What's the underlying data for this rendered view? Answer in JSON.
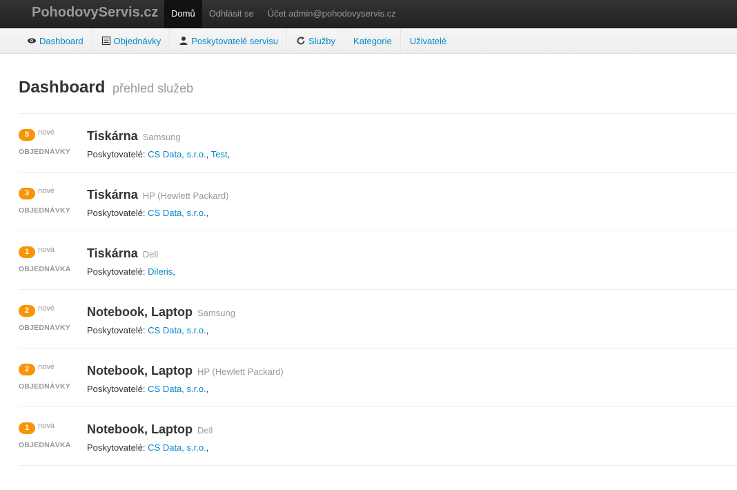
{
  "navbar": {
    "brand": "PohodovyServis.cz",
    "links": [
      {
        "label": "Domů",
        "active": true
      },
      {
        "label": "Odhlásit se",
        "active": false
      },
      {
        "label": "Účet admin@pohodovyservis.cz",
        "active": false
      }
    ]
  },
  "subnav": {
    "items": [
      {
        "label": "Dashboard",
        "icon": "eye-icon"
      },
      {
        "label": "Objednávky",
        "icon": "list-icon"
      },
      {
        "label": "Poskytovatelé servisu",
        "icon": "user-icon"
      },
      {
        "label": "Služby",
        "icon": "refresh-icon"
      },
      {
        "label": "Kategorie",
        "icon": ""
      },
      {
        "label": "Uživatelé",
        "icon": ""
      }
    ]
  },
  "page": {
    "title": "Dashboard",
    "subtitle": "přehled služeb"
  },
  "providers_label": "Poskytovatelé:",
  "services": [
    {
      "count": "5",
      "new_label": "nové",
      "order_label": "OBJEDNÁVKY",
      "category": "Tiskárna",
      "brand": "Samsung",
      "providers": [
        "CS Data, s.r.o.",
        "Test"
      ]
    },
    {
      "count": "3",
      "new_label": "nové",
      "order_label": "OBJEDNÁVKY",
      "category": "Tiskárna",
      "brand": "HP (Hewlett Packard)",
      "providers": [
        "CS Data, s.r.o."
      ]
    },
    {
      "count": "1",
      "new_label": "nová",
      "order_label": "OBJEDNÁVKA",
      "category": "Tiskárna",
      "brand": "Dell",
      "providers": [
        "Dileris"
      ]
    },
    {
      "count": "2",
      "new_label": "nové",
      "order_label": "OBJEDNÁVKY",
      "category": "Notebook, Laptop",
      "brand": "Samsung",
      "providers": [
        "CS Data, s.r.o."
      ]
    },
    {
      "count": "2",
      "new_label": "nové",
      "order_label": "OBJEDNÁVKY",
      "category": "Notebook, Laptop",
      "brand": "HP (Hewlett Packard)",
      "providers": [
        "CS Data, s.r.o."
      ]
    },
    {
      "count": "1",
      "new_label": "nová",
      "order_label": "OBJEDNÁVKA",
      "category": "Notebook, Laptop",
      "brand": "Dell",
      "providers": [
        "CS Data, s.r.o."
      ]
    }
  ],
  "colors": {
    "accent": "#0088cc",
    "badge": "#f89406",
    "navbar": "#222222"
  }
}
